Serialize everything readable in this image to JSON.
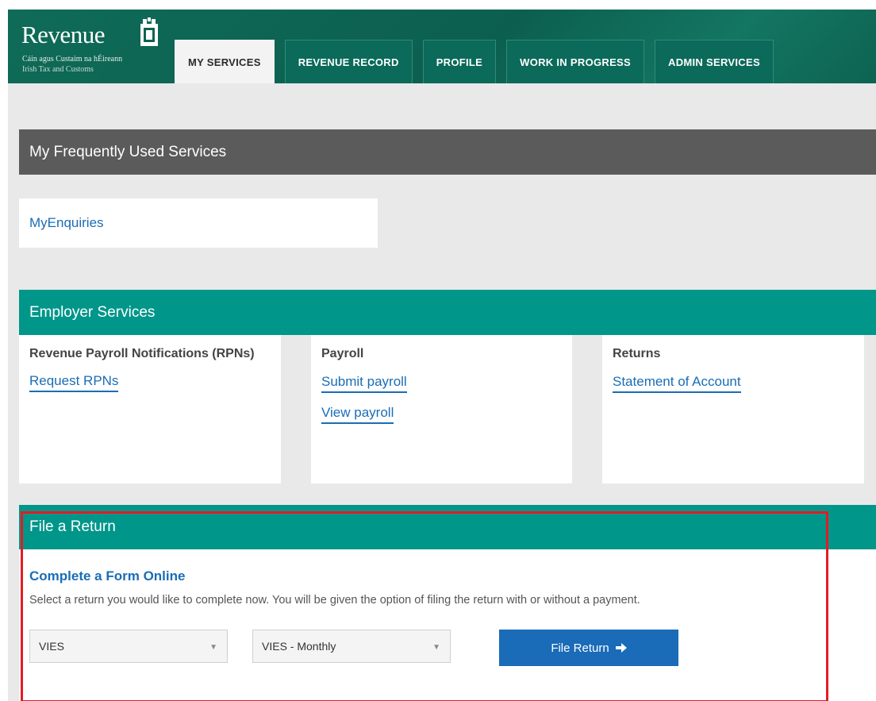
{
  "header": {
    "logo_text": "Revenue",
    "logo_subtitle_irish": "Cáin agus Custaim na hÉireann",
    "logo_subtitle_english": "Irish Tax and Customs",
    "tabs": [
      {
        "label": "MY SERVICES",
        "active": true
      },
      {
        "label": "REVENUE RECORD",
        "active": false
      },
      {
        "label": "PROFILE",
        "active": false
      },
      {
        "label": "WORK IN PROGRESS",
        "active": false
      },
      {
        "label": "ADMIN SERVICES",
        "active": false
      }
    ]
  },
  "frequent": {
    "title": "My Frequently Used Services",
    "items": [
      "MyEnquiries"
    ]
  },
  "employer": {
    "title": "Employer Services",
    "cards": [
      {
        "title": "Revenue Payroll Notifications (RPNs)",
        "links": [
          "Request RPNs"
        ]
      },
      {
        "title": "Payroll",
        "links": [
          "Submit payroll",
          "View payroll"
        ]
      },
      {
        "title": "Returns",
        "links": [
          "Statement of Account"
        ]
      }
    ]
  },
  "file_return": {
    "title": "File a Return",
    "heading": "Complete a Form Online",
    "description": "Select a return you would like to complete now. You will be given the option of filing the return with or without a payment.",
    "return_type": "VIES",
    "period": "VIES - Monthly",
    "button_label": "File Return"
  },
  "colors": {
    "header_green": "#0c5f4f",
    "teal": "#00968a",
    "link_blue": "#1a6db5",
    "highlight_red": "#e41b23"
  },
  "icons": {
    "logo_icon": "harp-icon",
    "select_arrow": "chevron-down-icon",
    "button_icon": "arrow-right-icon"
  }
}
